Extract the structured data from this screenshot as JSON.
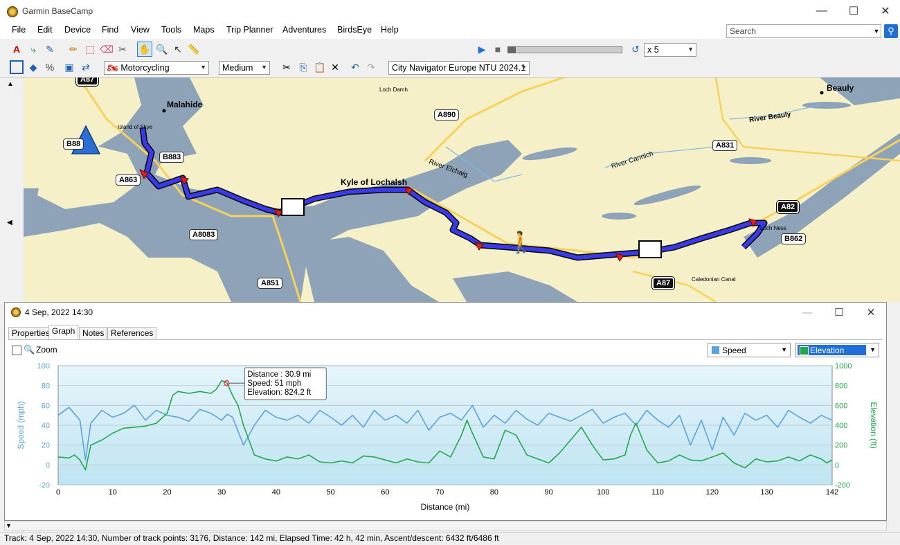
{
  "window": {
    "title": "Garmin BaseCamp",
    "minimize": "—",
    "maximize": "☐",
    "close": "✕"
  },
  "menu": [
    "File",
    "Edit",
    "Device",
    "Find",
    "View",
    "Tools",
    "Maps",
    "Trip Planner",
    "Adventures",
    "BirdsEye",
    "Help"
  ],
  "search": {
    "placeholder": "Search"
  },
  "toolbar": {
    "playback_speed": "x 5",
    "activity_profile": "Motorcycling",
    "detail_level": "Medium",
    "map_product": "City Navigator Europe NTU 2024.1"
  },
  "map": {
    "places": [
      {
        "name": "Malahide",
        "kind": "town"
      },
      {
        "name": "Kyle of Lochalsh",
        "kind": "town"
      },
      {
        "name": "Beauly",
        "kind": "town"
      },
      {
        "name": "Island of Skye",
        "kind": "small"
      },
      {
        "name": "Loch Damh",
        "kind": "small"
      },
      {
        "name": "Loch Ness",
        "kind": "small"
      },
      {
        "name": "Caledonian Canal",
        "kind": "small"
      },
      {
        "name": "River Beauly",
        "kind": "water"
      },
      {
        "name": "River Cannich",
        "kind": "water"
      },
      {
        "name": "River Elchaig",
        "kind": "water"
      }
    ],
    "roads": [
      "A87",
      "B883",
      "A863",
      "A8083",
      "A851",
      "A890",
      "A831",
      "A82",
      "B862",
      "A87",
      "B88"
    ]
  },
  "graph_window": {
    "title": "4 Sep, 2022 14:30",
    "tabs": [
      "Properties",
      "Graph",
      "Notes",
      "References"
    ],
    "active_tab": "Graph",
    "zoom_label": "Zoom",
    "left_series_select": {
      "label": "Speed",
      "color": "#5ba3e0"
    },
    "right_series_select": {
      "label": "Elevation",
      "color": "#22a84a"
    },
    "tooltip": {
      "line1": "Distance  : 30.9 mi",
      "line2": "Speed: 51 mph",
      "line3": "Elevation: 824.2 ft"
    }
  },
  "chart_data": {
    "type": "line",
    "xlabel": "Distance  (mi)",
    "ylabel": "Speed (mph)",
    "y2label": "Elevation (ft)",
    "xlim": [
      0,
      142
    ],
    "ylim": [
      -20,
      100
    ],
    "y2lim": [
      -200,
      1000
    ],
    "x_ticks": [
      0,
      10,
      20,
      30,
      40,
      50,
      60,
      70,
      80,
      90,
      100,
      110,
      120,
      130,
      142
    ],
    "y_ticks": [
      -20,
      0,
      20,
      40,
      60,
      80,
      100
    ],
    "y2_ticks": [
      -200,
      0,
      200,
      400,
      600,
      800,
      1000
    ],
    "grid": true,
    "series": [
      {
        "name": "Speed",
        "axis": "left",
        "color": "#5ba3e0",
        "x": [
          0,
          2,
          4,
          5,
          6,
          8,
          10,
          12,
          14,
          16,
          18,
          20,
          22,
          24,
          26,
          28,
          30,
          31,
          32,
          34,
          36,
          38,
          40,
          42,
          44,
          46,
          48,
          50,
          52,
          54,
          56,
          58,
          60,
          62,
          64,
          66,
          68,
          70,
          72,
          74,
          76,
          78,
          80,
          82,
          84,
          86,
          88,
          90,
          92,
          94,
          96,
          98,
          100,
          102,
          104,
          106,
          108,
          110,
          112,
          114,
          116,
          118,
          120,
          122,
          124,
          126,
          128,
          130,
          132,
          134,
          136,
          138,
          140,
          142
        ],
        "y": [
          50,
          58,
          45,
          5,
          42,
          55,
          48,
          52,
          60,
          45,
          55,
          50,
          48,
          44,
          56,
          52,
          45,
          51,
          48,
          20,
          40,
          55,
          48,
          45,
          50,
          42,
          55,
          48,
          40,
          50,
          38,
          55,
          45,
          50,
          42,
          55,
          35,
          48,
          52,
          45,
          60,
          38,
          50,
          42,
          55,
          46,
          40,
          52,
          48,
          44,
          50,
          56,
          42,
          48,
          52,
          40,
          55,
          45,
          38,
          50,
          20,
          45,
          15,
          48,
          30,
          52,
          45,
          50,
          38,
          55,
          48,
          42,
          50,
          45
        ]
      },
      {
        "name": "Elevation",
        "axis": "right",
        "color": "#22a84a",
        "x": [
          0,
          2,
          3,
          4,
          5,
          6,
          8,
          10,
          12,
          14,
          16,
          18,
          20,
          21,
          22,
          24,
          26,
          28,
          29,
          30,
          31,
          32,
          33,
          34,
          35,
          36,
          38,
          40,
          42,
          44,
          46,
          48,
          50,
          52,
          54,
          56,
          58,
          60,
          62,
          64,
          66,
          68,
          70,
          72,
          74,
          75,
          76,
          78,
          80,
          82,
          84,
          86,
          88,
          90,
          92,
          94,
          96,
          98,
          100,
          102,
          104,
          105,
          106,
          108,
          110,
          112,
          114,
          116,
          118,
          120,
          122,
          124,
          126,
          128,
          130,
          132,
          134,
          136,
          138,
          140,
          141,
          142
        ],
        "y": [
          80,
          70,
          100,
          50,
          -50,
          200,
          250,
          320,
          370,
          380,
          390,
          420,
          520,
          700,
          740,
          720,
          740,
          720,
          760,
          850,
          824,
          700,
          600,
          400,
          250,
          100,
          60,
          40,
          80,
          60,
          100,
          30,
          20,
          40,
          20,
          90,
          80,
          50,
          20,
          60,
          30,
          20,
          140,
          80,
          300,
          450,
          320,
          80,
          60,
          350,
          300,
          100,
          60,
          20,
          120,
          250,
          380,
          200,
          50,
          60,
          100,
          300,
          420,
          150,
          20,
          40,
          100,
          50,
          40,
          80,
          120,
          20,
          -30,
          60,
          30,
          40,
          80,
          40,
          100,
          60,
          20,
          50
        ]
      }
    ]
  },
  "status": {
    "text": "Track: 4 Sep, 2022 14:30, Number of track points: 3176, Distance: 142 mi, Elapsed Time: 42 h, 42 min, Ascent/descent: 6432 ft/6486 ft"
  }
}
